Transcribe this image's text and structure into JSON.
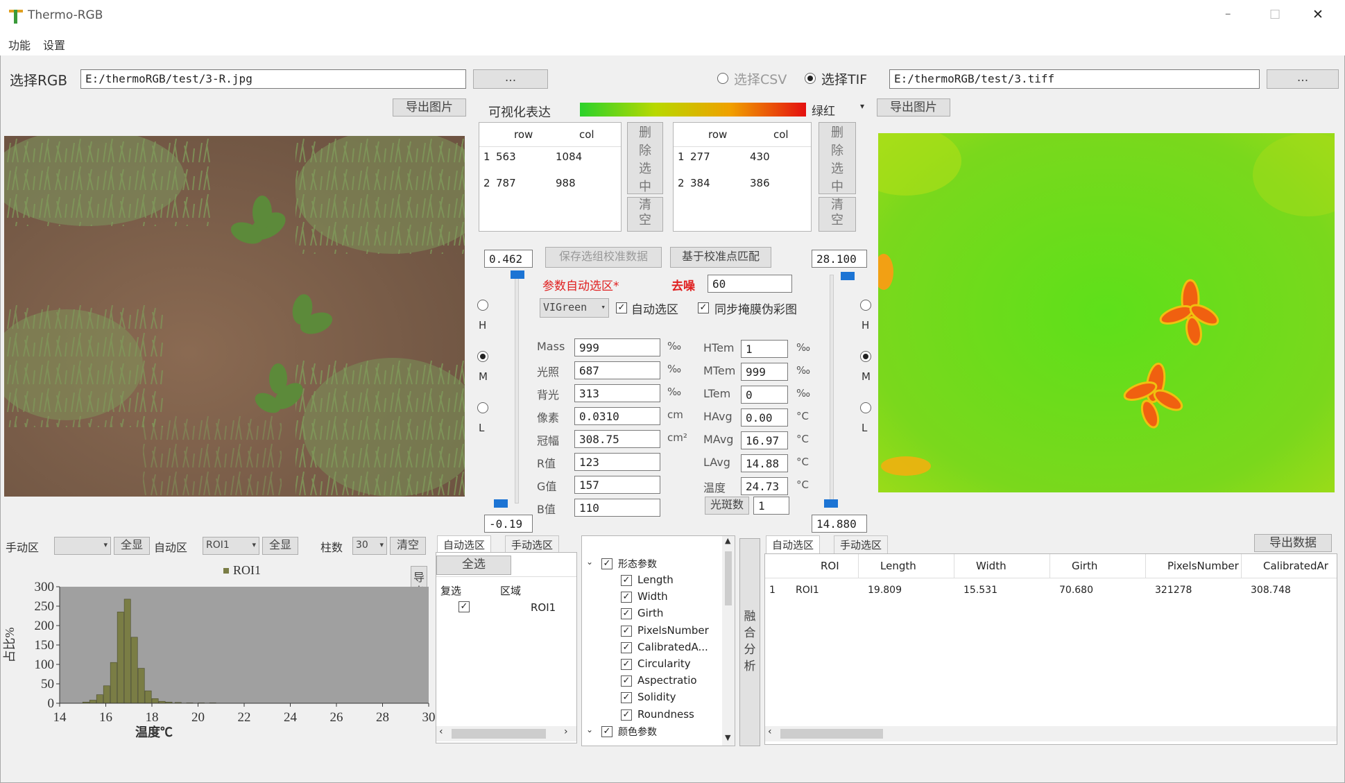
{
  "window": {
    "title": "Thermo-RGB",
    "minimize": "–",
    "maximize": "□",
    "close": "✕"
  },
  "menu": [
    "功能",
    "设置"
  ],
  "rgb_row": {
    "label": "选择RGB",
    "path": "E:/thermoRGB/test/3-R.jpg",
    "browse": "..."
  },
  "tif_row": {
    "csv_label": "选择CSV",
    "tif_label": "选择TIF",
    "path": "E:/thermoRGB/test/3.tiff",
    "browse": "..."
  },
  "export_image_left": "导出图片",
  "export_image_right": "导出图片",
  "visualization": {
    "label": "可视化表达",
    "colormap": "绿红"
  },
  "left_table": {
    "headers": [
      "row",
      "col"
    ],
    "rows": [
      {
        "idx": "1",
        "row": "563",
        "col": "1084"
      },
      {
        "idx": "2",
        "row": "787",
        "col": "988"
      }
    ],
    "delete_btn": "删除选中",
    "clear_btn": "清空"
  },
  "right_table": {
    "headers": [
      "row",
      "col"
    ],
    "rows": [
      {
        "idx": "1",
        "row": "277",
        "col": "430"
      },
      {
        "idx": "2",
        "row": "384",
        "col": "386"
      }
    ],
    "delete_btn": "删除选中",
    "clear_btn": "清空"
  },
  "left_slider": {
    "top_value": "0.462",
    "bottom_value": "-0.19",
    "options": [
      "H",
      "M",
      "L"
    ],
    "selected": "M"
  },
  "right_slider": {
    "top_value": "28.100",
    "bottom_value": "14.880",
    "options": [
      "H",
      "M",
      "L"
    ],
    "selected": "M"
  },
  "calibration": {
    "save_btn": "保存选组校准数据",
    "match_btn": "基于校准点匹配",
    "auto_select_label": "参数自动选区*",
    "denoise_label": "去噪",
    "denoise_value": "60",
    "index_select": "VIGreen",
    "auto_region_label": "自动选区",
    "sync_mask_label": "同步掩膜伪彩图"
  },
  "left_params": [
    {
      "label": "Mass",
      "value": "999",
      "unit": "‰"
    },
    {
      "label": "光照",
      "value": "687",
      "unit": "‰"
    },
    {
      "label": "背光",
      "value": "313",
      "unit": "‰"
    },
    {
      "label": "像素",
      "value": "0.0310",
      "unit": "cm"
    },
    {
      "label": "冠幅",
      "value": "308.75",
      "unit": "cm²"
    },
    {
      "label": "R值",
      "value": "123",
      "unit": ""
    },
    {
      "label": "G值",
      "value": "157",
      "unit": ""
    },
    {
      "label": "B值",
      "value": "110",
      "unit": ""
    }
  ],
  "right_params": [
    {
      "label": "HTem",
      "value": "1",
      "unit": "‰"
    },
    {
      "label": "MTem",
      "value": "999",
      "unit": "‰"
    },
    {
      "label": "LTem",
      "value": "0",
      "unit": "‰"
    },
    {
      "label": "HAvg",
      "value": "0.00",
      "unit": "°C"
    },
    {
      "label": "MAvg",
      "value": "16.97",
      "unit": "°C"
    },
    {
      "label": "LAvg",
      "value": "14.88",
      "unit": "°C"
    },
    {
      "label": "温度",
      "value": "24.73",
      "unit": "°C"
    }
  ],
  "spot_count": {
    "label": "光斑数",
    "value": "1"
  },
  "hist_toolbar": {
    "manual_label": "手动区",
    "show_all_1": "全显",
    "auto_label": "自动区",
    "auto_select": "ROI1",
    "show_all_2": "全显",
    "bins_label": "柱数",
    "bins_value": "30",
    "clear": "清空"
  },
  "export_side_btn": "导出",
  "chart_data": {
    "type": "bar",
    "legend": "ROI1",
    "xlabel": "温度℃",
    "ylabel": "占比%",
    "xlim": [
      14,
      30
    ],
    "ylim": [
      0,
      300
    ],
    "xticks": [
      "14",
      "16",
      "18",
      "20",
      "22",
      "24",
      "26",
      "28",
      "30"
    ],
    "yticks": [
      "0",
      "50",
      "100",
      "150",
      "200",
      "250",
      "300"
    ],
    "bins_x": [
      15.0,
      15.3,
      15.6,
      15.9,
      16.2,
      16.5,
      16.8,
      17.1,
      17.4,
      17.7,
      18.0,
      18.3,
      18.6,
      19.0,
      19.5,
      20.0,
      20.5
    ],
    "values": [
      3,
      8,
      22,
      45,
      105,
      235,
      268,
      170,
      90,
      32,
      12,
      5,
      3,
      2,
      1,
      1,
      1
    ],
    "bar_color": "#7a7d45",
    "bg_color": "#a0a0a0"
  },
  "roi_tabs": [
    "自动选区",
    "手动选区"
  ],
  "roi_panel": {
    "select_all": "全选",
    "headers": [
      "复选",
      "区域"
    ],
    "items": [
      {
        "checked": true,
        "name": "ROI1"
      }
    ]
  },
  "tree": {
    "groups": [
      {
        "name": "形态参数",
        "items": [
          "Length",
          "Width",
          "Girth",
          "PixelsNumber",
          "CalibratedA...",
          "Circularity",
          "Aspectratio",
          "Solidity",
          "Roundness"
        ]
      },
      {
        "name": "颜色参数",
        "items": []
      }
    ]
  },
  "fusion_btn": "融合分析",
  "result_tabs": [
    "自动选区",
    "手动选区"
  ],
  "export_data_btn": "导出数据",
  "result_table": {
    "headers": [
      "ROI",
      "Length",
      "Width",
      "Girth",
      "PixelsNumber",
      "CalibratedAr"
    ],
    "rows": [
      {
        "idx": "1",
        "cells": [
          "ROI1",
          "19.809",
          "15.531",
          "70.680",
          "321278",
          "308.748"
        ]
      }
    ]
  }
}
